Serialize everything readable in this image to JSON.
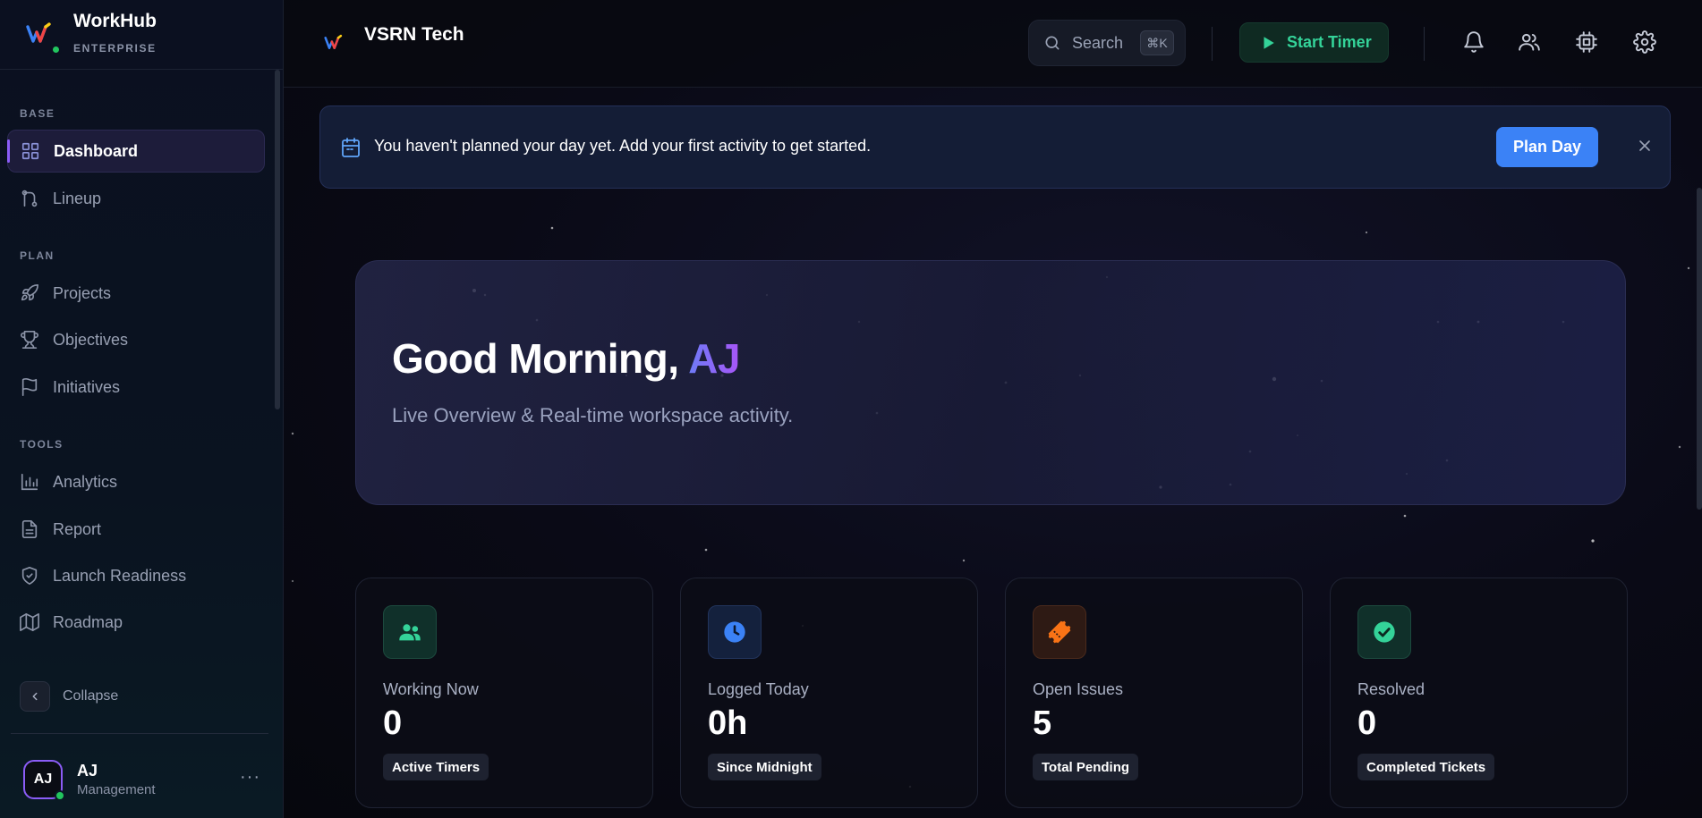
{
  "brand": {
    "name": "WorkHub",
    "tier": "ENTERPRISE"
  },
  "sidebar": {
    "sections": [
      {
        "label": "BASE",
        "items": [
          {
            "label": "Dashboard",
            "icon": "grid-icon",
            "active": true
          },
          {
            "label": "Lineup",
            "icon": "git-branch-icon"
          }
        ]
      },
      {
        "label": "PLAN",
        "items": [
          {
            "label": "Projects",
            "icon": "rocket-icon"
          },
          {
            "label": "Objectives",
            "icon": "trophy-icon"
          },
          {
            "label": "Initiatives",
            "icon": "flag-icon"
          }
        ]
      },
      {
        "label": "TOOLS",
        "items": [
          {
            "label": "Analytics",
            "icon": "bar-chart-icon"
          },
          {
            "label": "Report",
            "icon": "document-icon"
          },
          {
            "label": "Launch Readiness",
            "icon": "shield-check-icon"
          },
          {
            "label": "Roadmap",
            "icon": "map-icon"
          }
        ]
      }
    ],
    "collapse_label": "Collapse",
    "user": {
      "initials": "AJ",
      "name": "AJ",
      "role": "Management",
      "more": "···"
    }
  },
  "header": {
    "workspace": "VSRN Tech",
    "search_label": "Search",
    "search_shortcut": "⌘K",
    "timer_label": "Start Timer"
  },
  "banner": {
    "text": "You haven't planned your day yet. Add your first activity to get started.",
    "button_label": "Plan Day"
  },
  "hero": {
    "greeting": "Good Morning, ",
    "name": "AJ",
    "subtitle": "Live Overview & Real-time workspace activity."
  },
  "stats": [
    {
      "title": "Working Now",
      "value": "0",
      "tag": "Active Timers",
      "icon": "users-icon",
      "color": "#34d399"
    },
    {
      "title": "Logged Today",
      "value": "0h",
      "tag": "Since Midnight",
      "icon": "clock-icon",
      "color": "#60a5fa"
    },
    {
      "title": "Open Issues",
      "value": "5",
      "tag": "Total Pending",
      "icon": "ticket-icon",
      "color": "#f97316"
    },
    {
      "title": "Resolved",
      "value": "0",
      "tag": "Completed Tickets",
      "icon": "check-circle-icon",
      "color": "#34d399"
    }
  ],
  "colors": {
    "accent": "#8b5cf6",
    "primary_button": "#3b82f6",
    "success": "#22c55e"
  }
}
